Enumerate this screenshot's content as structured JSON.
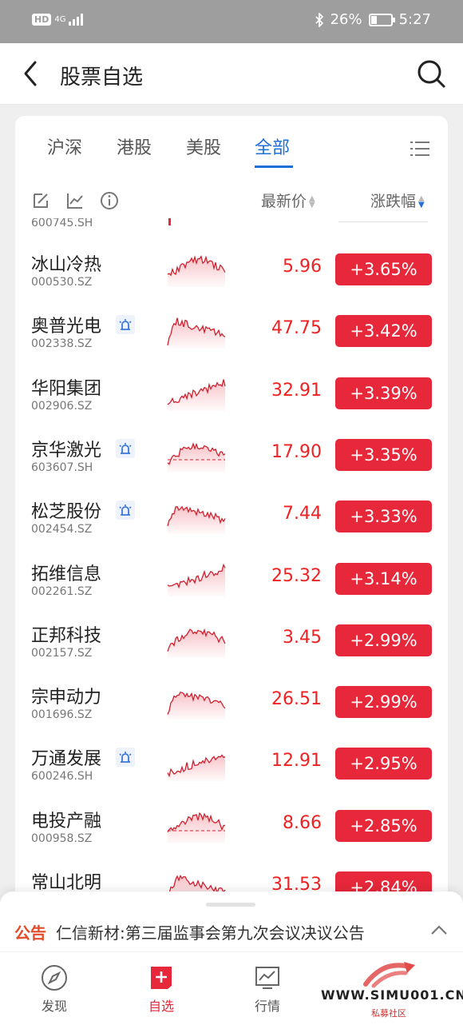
{
  "status_bar": {
    "network": "4G",
    "battery": "26%",
    "time": "5:27"
  },
  "header": {
    "title": "股票自选"
  },
  "tabs": [
    {
      "label": "沪深"
    },
    {
      "label": "港股"
    },
    {
      "label": "美股"
    },
    {
      "label": "全部",
      "active": true
    }
  ],
  "columns": {
    "price": "最新价",
    "change": "涨跌幅"
  },
  "partial_row": {
    "code": "600745.SH"
  },
  "stocks": [
    {
      "name": "冰山冷热",
      "code": "000530.SZ",
      "price": "5.96",
      "change": "+3.65%",
      "alert": false
    },
    {
      "name": "奥普光电",
      "code": "002338.SZ",
      "price": "47.75",
      "change": "+3.42%",
      "alert": true
    },
    {
      "name": "华阳集团",
      "code": "002906.SZ",
      "price": "32.91",
      "change": "+3.39%",
      "alert": false
    },
    {
      "name": "京华激光",
      "code": "603607.SH",
      "price": "17.90",
      "change": "+3.35%",
      "alert": true
    },
    {
      "name": "松芝股份",
      "code": "002454.SZ",
      "price": "7.44",
      "change": "+3.33%",
      "alert": true
    },
    {
      "name": "拓维信息",
      "code": "002261.SZ",
      "price": "25.32",
      "change": "+3.14%",
      "alert": false
    },
    {
      "name": "正邦科技",
      "code": "002157.SZ",
      "price": "3.45",
      "change": "+2.99%",
      "alert": false
    },
    {
      "name": "宗申动力",
      "code": "001696.SZ",
      "price": "26.51",
      "change": "+2.99%",
      "alert": false
    },
    {
      "name": "万通发展",
      "code": "600246.SH",
      "price": "12.91",
      "change": "+2.95%",
      "alert": true
    },
    {
      "name": "电投产融",
      "code": "000958.SZ",
      "price": "8.66",
      "change": "+2.85%",
      "alert": false
    },
    {
      "name": "常山北明",
      "code": "",
      "price": "31.53",
      "change": "+2.84%",
      "alert": false
    }
  ],
  "notice": {
    "tag": "公告",
    "text": "仁信新材:第三届监事会第九次会议决议公告"
  },
  "bottom_nav": [
    {
      "label": "发现",
      "icon": "compass-icon"
    },
    {
      "label": "自选",
      "icon": "plus-square-icon",
      "active": true
    },
    {
      "label": "行情",
      "icon": "chart-monitor-icon"
    }
  ],
  "watermark": {
    "url": "WWW.SIMU001.CN",
    "sub": "私募社区"
  },
  "colors": {
    "up": "#e6283a",
    "accent": "#1e6fd9",
    "notice": "#e24a2a"
  }
}
